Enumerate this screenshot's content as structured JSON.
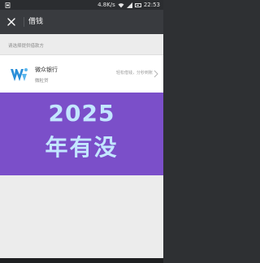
{
  "status_bar": {
    "speed": "4.8K/s",
    "time": "22:53",
    "icons": [
      "sim-icon",
      "signal-icon",
      "wifi-icon",
      "battery-icon"
    ]
  },
  "title_bar": {
    "title": "借钱",
    "close_icon": "close-icon"
  },
  "section": {
    "caption": "请选择提供借款方"
  },
  "provider": {
    "name": "微众银行",
    "product": "微粒贷",
    "slogan": "轻松借钱，分秒到账",
    "logo_icon": "webank-logo-icon",
    "chevron_icon": "chevron-right-icon"
  },
  "overlay": {
    "line1": "2025",
    "line2": "年有没"
  },
  "colors": {
    "title_bar": "#393b3f",
    "overlay": "#7b4fc9",
    "overlay_text": "#c3e6ff",
    "logo_blue": "#2a8ed8"
  }
}
